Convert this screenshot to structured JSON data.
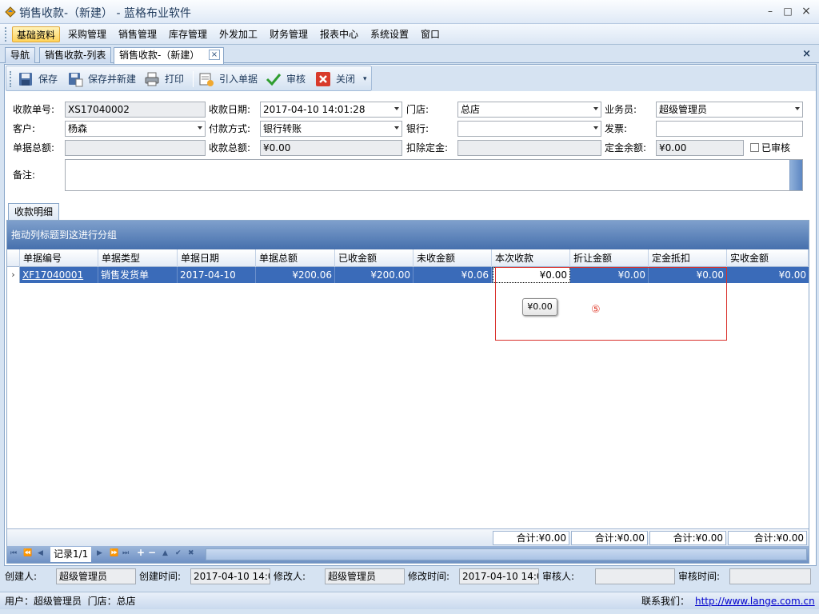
{
  "window": {
    "title": "销售收款-（新建） - 蓝格布业软件",
    "minimize": "–",
    "maximize": "□",
    "close": "×"
  },
  "menu": [
    "基础资料",
    "采购管理",
    "销售管理",
    "库存管理",
    "外发加工",
    "财务管理",
    "报表中心",
    "系统设置",
    "窗口"
  ],
  "tabs": [
    "导航",
    "销售收款-列表",
    "销售收款-（新建）"
  ],
  "tab_close": "×",
  "strip_close": "×",
  "toolbar": {
    "save": "保存",
    "save_new": "保存并新建",
    "print": "打印",
    "import": "引入单据",
    "audit": "审核",
    "close": "关闭",
    "more": "▾"
  },
  "form": {
    "receipt_no_label": "收款单号:",
    "receipt_no": "XS17040002",
    "receipt_date_label": "收款日期:",
    "receipt_date": "2017-04-10 14:01:28",
    "store_label": "门店:",
    "store": "总店",
    "salesman_label": "业务员:",
    "salesman": "超级管理员",
    "customer_label": "客户:",
    "customer": "杨森",
    "pay_method_label": "付款方式:",
    "pay_method": "银行转账",
    "bank_label": "银行:",
    "bank": "",
    "invoice_label": "发票:",
    "invoice": "",
    "doc_total_label": "单据总额:",
    "doc_total": "",
    "receipt_total_label": "收款总额:",
    "receipt_total": "¥0.00",
    "deduct_deposit_label": "扣除定金:",
    "deduct_deposit": "",
    "deposit_balance_label": "定金余额:",
    "deposit_balance": "¥0.00",
    "audited_label": "已审核",
    "remark_label": "备注:"
  },
  "detail_tab": "收款明细",
  "grid": {
    "group_hint": "拖动列标题到这进行分组",
    "headers": [
      "单据编号",
      "单据类型",
      "单据日期",
      "单据总额",
      "已收金额",
      "未收金额",
      "本次收款",
      "折让金额",
      "定金抵扣",
      "实收金额"
    ],
    "row": [
      "XF17040001",
      "销售发货单",
      "2017-04-10",
      "¥200.06",
      "¥200.00",
      "¥0.06",
      "¥0.00",
      "¥0.00",
      "¥0.00",
      "¥0.00"
    ],
    "row_indicator": "›",
    "tooltip": "¥0.00",
    "annotation": "⑤",
    "footer": [
      "合计:¥0.00",
      "合计:¥0.00",
      "合计:¥0.00",
      "合计:¥0.00"
    ],
    "nav_record": "记录1/1"
  },
  "audit": {
    "creator_label": "创建人:",
    "creator": "超级管理员",
    "create_time_label": "创建时间:",
    "create_time": "2017-04-10 14:0",
    "modifier_label": "修改人:",
    "modifier": "超级管理员",
    "modify_time_label": "修改时间:",
    "modify_time": "2017-04-10 14:0",
    "auditor_label": "审核人:",
    "auditor": "",
    "audit_time_label": "审核时间:",
    "audit_time": ""
  },
  "status": {
    "user": "用户：超级管理员  门店：总店",
    "contact_label": "联系我们：",
    "contact_url": "http://www.lange.com.cn"
  }
}
